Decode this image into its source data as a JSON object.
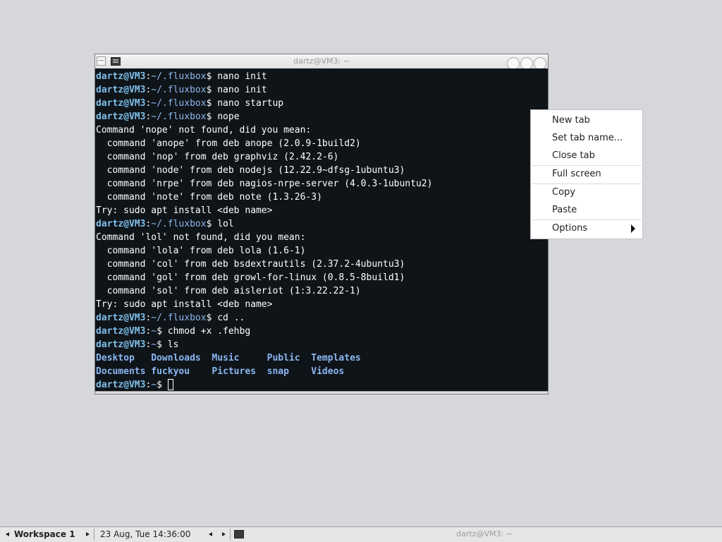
{
  "window": {
    "title": "dartz@VM3: ~",
    "minimize_glyph": "—"
  },
  "prompt": {
    "user": "dartz@VM3",
    "sep": ":"
  },
  "terminal_lines": [
    {
      "kind": "prompt",
      "path": "~/.fluxbox",
      "cmd": " nano init"
    },
    {
      "kind": "prompt",
      "path": "~/.fluxbox",
      "cmd": " nano init"
    },
    {
      "kind": "prompt",
      "path": "~/.fluxbox",
      "cmd": " nano startup"
    },
    {
      "kind": "prompt",
      "path": "~/.fluxbox",
      "cmd": " nope"
    },
    {
      "kind": "text",
      "text": "Command 'nope' not found, did you mean:"
    },
    {
      "kind": "text",
      "text": "  command 'anope' from deb anope (2.0.9-1build2)"
    },
    {
      "kind": "text",
      "text": "  command 'nop' from deb graphviz (2.42.2-6)"
    },
    {
      "kind": "text",
      "text": "  command 'node' from deb nodejs (12.22.9~dfsg-1ubuntu3)"
    },
    {
      "kind": "text",
      "text": "  command 'nrpe' from deb nagios-nrpe-server (4.0.3-1ubuntu2)"
    },
    {
      "kind": "text",
      "text": "  command 'note' from deb note (1.3.26-3)"
    },
    {
      "kind": "text",
      "text": "Try: sudo apt install <deb name>"
    },
    {
      "kind": "prompt",
      "path": "~/.fluxbox",
      "cmd": " lol"
    },
    {
      "kind": "text",
      "text": "Command 'lol' not found, did you mean:"
    },
    {
      "kind": "text",
      "text": "  command 'lola' from deb lola (1.6-1)"
    },
    {
      "kind": "text",
      "text": "  command 'col' from deb bsdextrautils (2.37.2-4ubuntu3)"
    },
    {
      "kind": "text",
      "text": "  command 'gol' from deb growl-for-linux (0.8.5-8build1)"
    },
    {
      "kind": "text",
      "text": "  command 'sol' from deb aisleriot (1:3.22.22-1)"
    },
    {
      "kind": "text",
      "text": "Try: sudo apt install <deb name>"
    },
    {
      "kind": "prompt",
      "path": "~/.fluxbox",
      "cmd": " cd .."
    },
    {
      "kind": "prompt",
      "path": "~",
      "cmd": " chmod +x .fehbg"
    },
    {
      "kind": "prompt",
      "path": "~",
      "cmd": " ls"
    },
    {
      "kind": "ls",
      "items": [
        "Desktop   ",
        "Downloads  ",
        "Music     ",
        "Public  ",
        "Templates"
      ]
    },
    {
      "kind": "ls",
      "items": [
        "Documents ",
        "fuckyou    ",
        "Pictures  ",
        "snap    ",
        "Videos"
      ]
    },
    {
      "kind": "cursor",
      "path": "~",
      "cmd": " "
    }
  ],
  "context_menu": {
    "items": {
      "new_tab": "New tab",
      "set_tab_name": "Set tab name...",
      "close_tab": "Close tab",
      "full_screen": "Full screen",
      "copy": "Copy",
      "paste": "Paste",
      "options": "Options"
    }
  },
  "taskbar": {
    "workspace": "Workspace 1",
    "clock": "23 Aug, Tue 14:36:00",
    "task_title": "dartz@VM3: ~"
  }
}
